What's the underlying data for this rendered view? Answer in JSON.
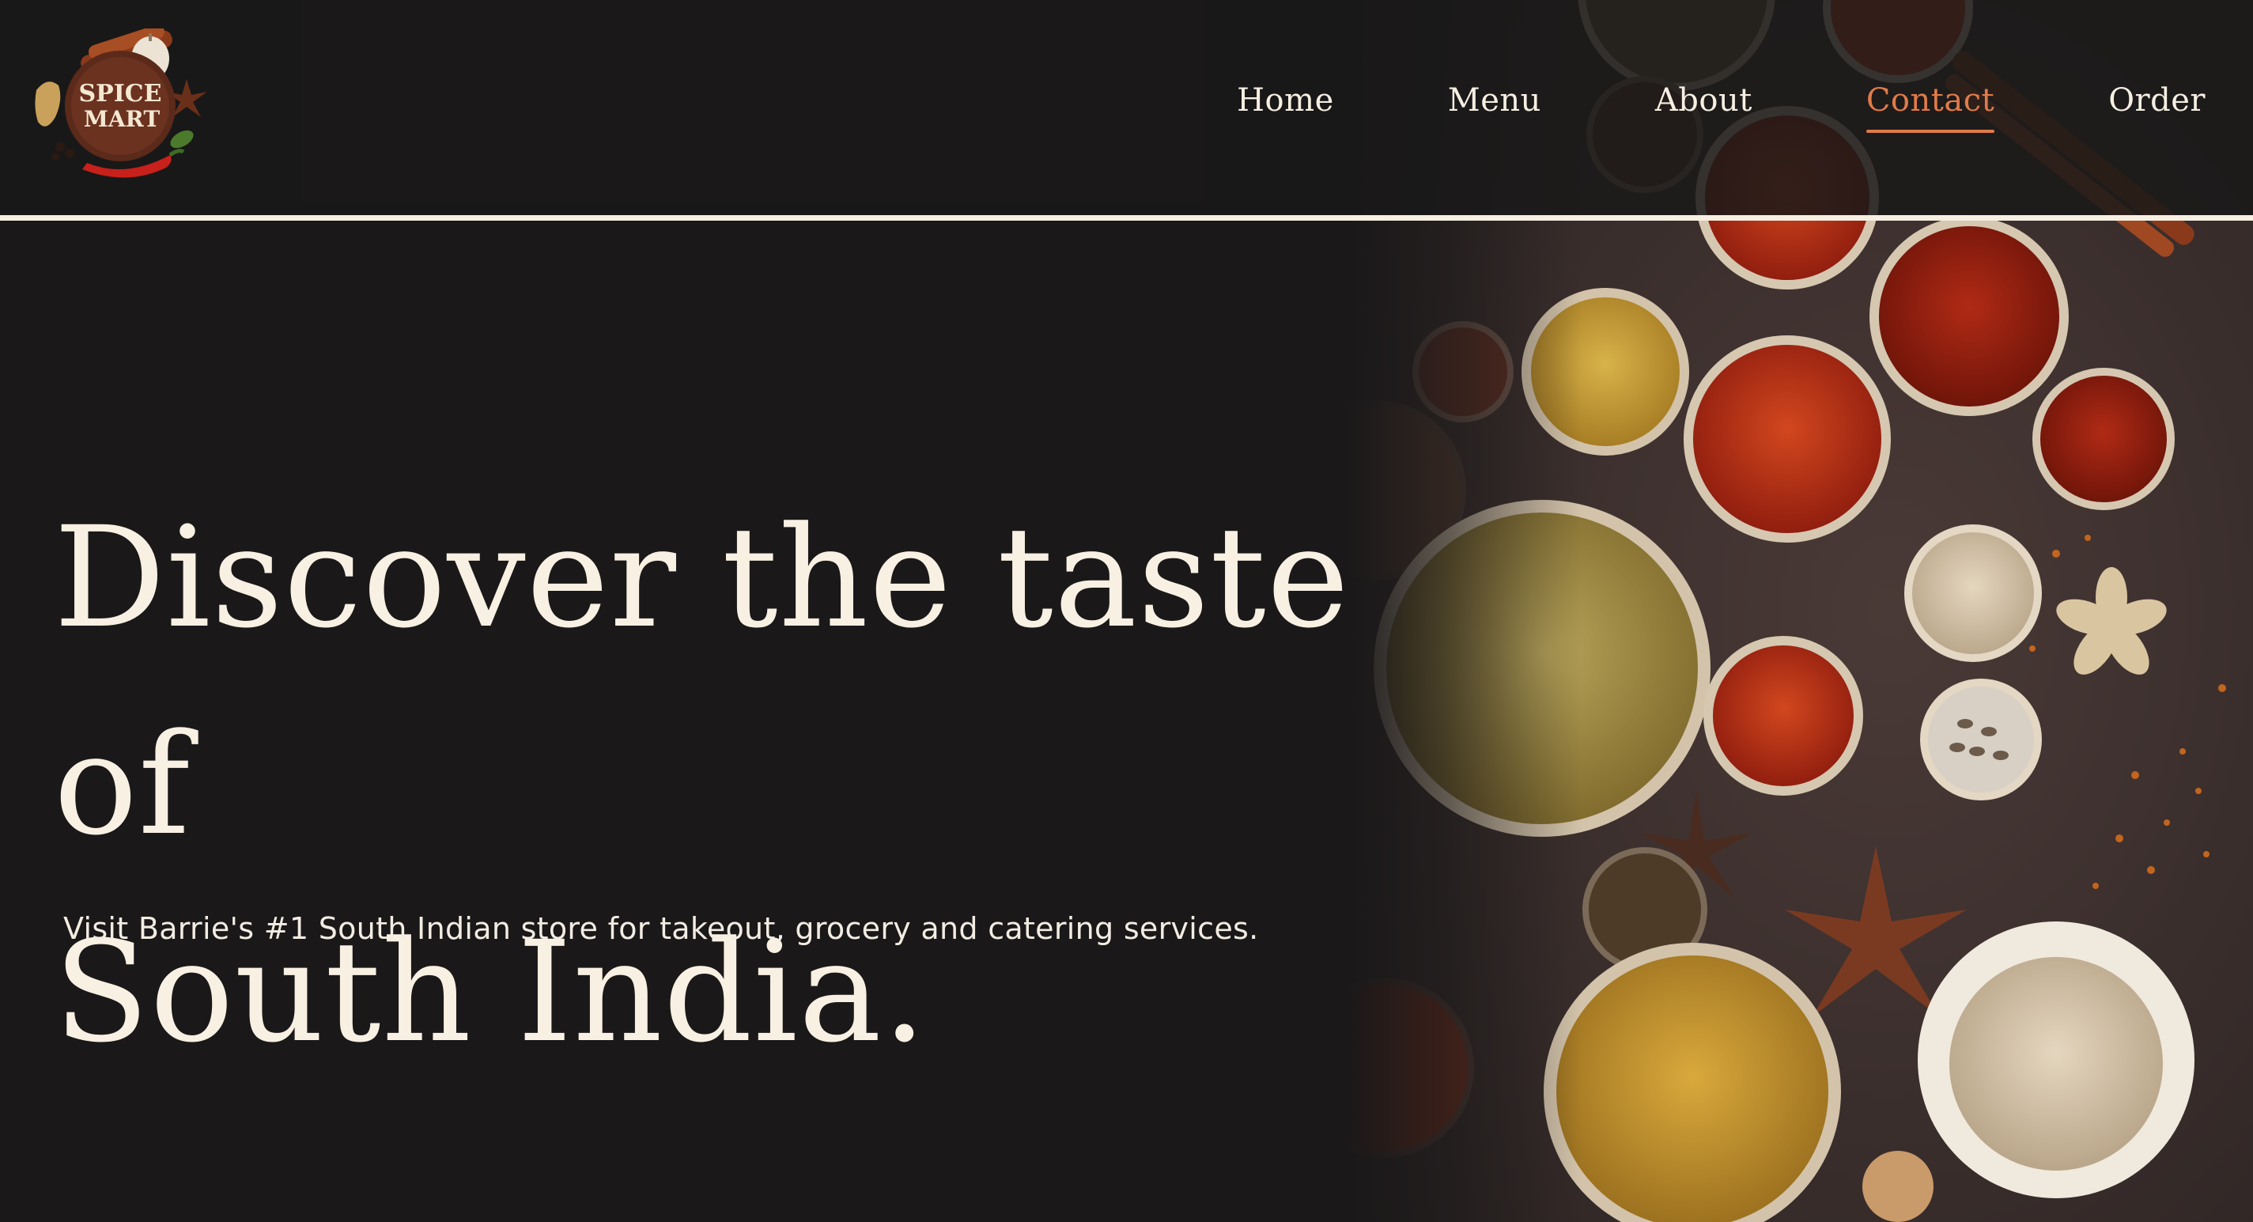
{
  "brand": {
    "logo_text": "SPICE MART",
    "logo_icon": "spice-mart-logo"
  },
  "nav": {
    "items": [
      {
        "label": "Home",
        "active": false
      },
      {
        "label": "Menu",
        "active": false
      },
      {
        "label": "About",
        "active": false
      },
      {
        "label": "Contact",
        "active": true
      },
      {
        "label": "Order",
        "active": false
      }
    ]
  },
  "hero": {
    "title_line1": "Discover the taste of",
    "title_line2": "South India.",
    "subtitle": "Visit Barrie's #1 South Indian store for takeout, grocery and catering services.",
    "image": "spice-bowls-photo"
  },
  "colors": {
    "background": "#1a1819",
    "text": "#f8f0e2",
    "accent": "#e07b48",
    "divider": "#f6efe2"
  }
}
